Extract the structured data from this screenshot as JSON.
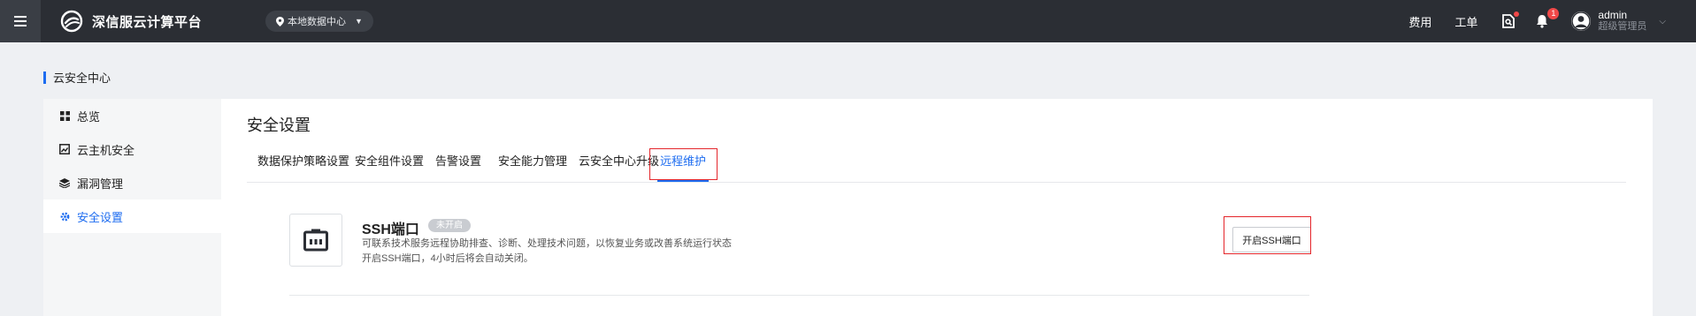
{
  "app": {
    "title": "深信服云计算平台"
  },
  "header": {
    "datacenter": "本地数据中心",
    "links": {
      "cost": "费用",
      "ticket": "工单"
    },
    "notifications": {
      "count": "1"
    },
    "user": {
      "name": "admin",
      "role": "超级管理员"
    }
  },
  "breadcrumb": "云安全中心",
  "sidebar": {
    "items": [
      {
        "label": "总览",
        "icon": "grid-icon"
      },
      {
        "label": "云主机安全",
        "icon": "host-security-icon"
      },
      {
        "label": "漏洞管理",
        "icon": "layers-icon"
      },
      {
        "label": "安全设置",
        "icon": "gear-icon",
        "active": true
      }
    ]
  },
  "main": {
    "title": "安全设置",
    "tabs": [
      {
        "label": "数据保护策略设置"
      },
      {
        "label": "安全组件设置"
      },
      {
        "label": "告警设置"
      },
      {
        "label": "安全能力管理"
      },
      {
        "label": "云安全中心升级"
      },
      {
        "label": "远程维护",
        "active": true
      }
    ],
    "ssh": {
      "title": "SSH端口",
      "status": "未开启",
      "desc_line1": "可联系技术服务远程协助排查、诊断、处理技术问题，以恢复业务或改善系统运行状态",
      "desc_line2": "开启SSH端口，4小时后将会自动关闭。",
      "button": "开启SSH端口"
    }
  },
  "colors": {
    "accent": "#1d6cf0",
    "topbar": "#2b2e34",
    "highlight": "#e4262b"
  }
}
